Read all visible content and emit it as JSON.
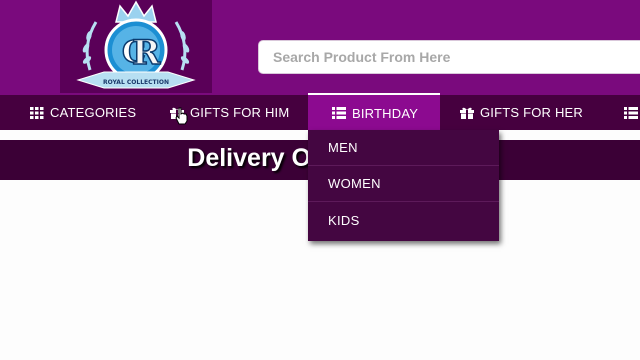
{
  "logo": {
    "letters": "RC",
    "ribbon_text": "ROYAL COLLECTION"
  },
  "search": {
    "placeholder": "Search Product From Here",
    "value": ""
  },
  "nav": {
    "items": [
      {
        "label": "CATEGORIES",
        "icon": "grid-icon"
      },
      {
        "label": "GIFTS FOR HIM",
        "icon": "gift-icon"
      },
      {
        "label": "BIRTHDAY",
        "icon": "list-icon"
      },
      {
        "label": "GIFTS FOR HER",
        "icon": "gift-icon"
      }
    ],
    "overflow_icon": "list-icon"
  },
  "dropdown": {
    "items": [
      "MEN",
      "WOMEN",
      "KIDS"
    ]
  },
  "banner": {
    "title": "Delivery On Same Day"
  },
  "colors": {
    "header": "#7a0a7d",
    "navbar": "#46003f",
    "active_tab": "#8c0a90",
    "dropdown": "#440641",
    "banner": "#3b0036"
  }
}
